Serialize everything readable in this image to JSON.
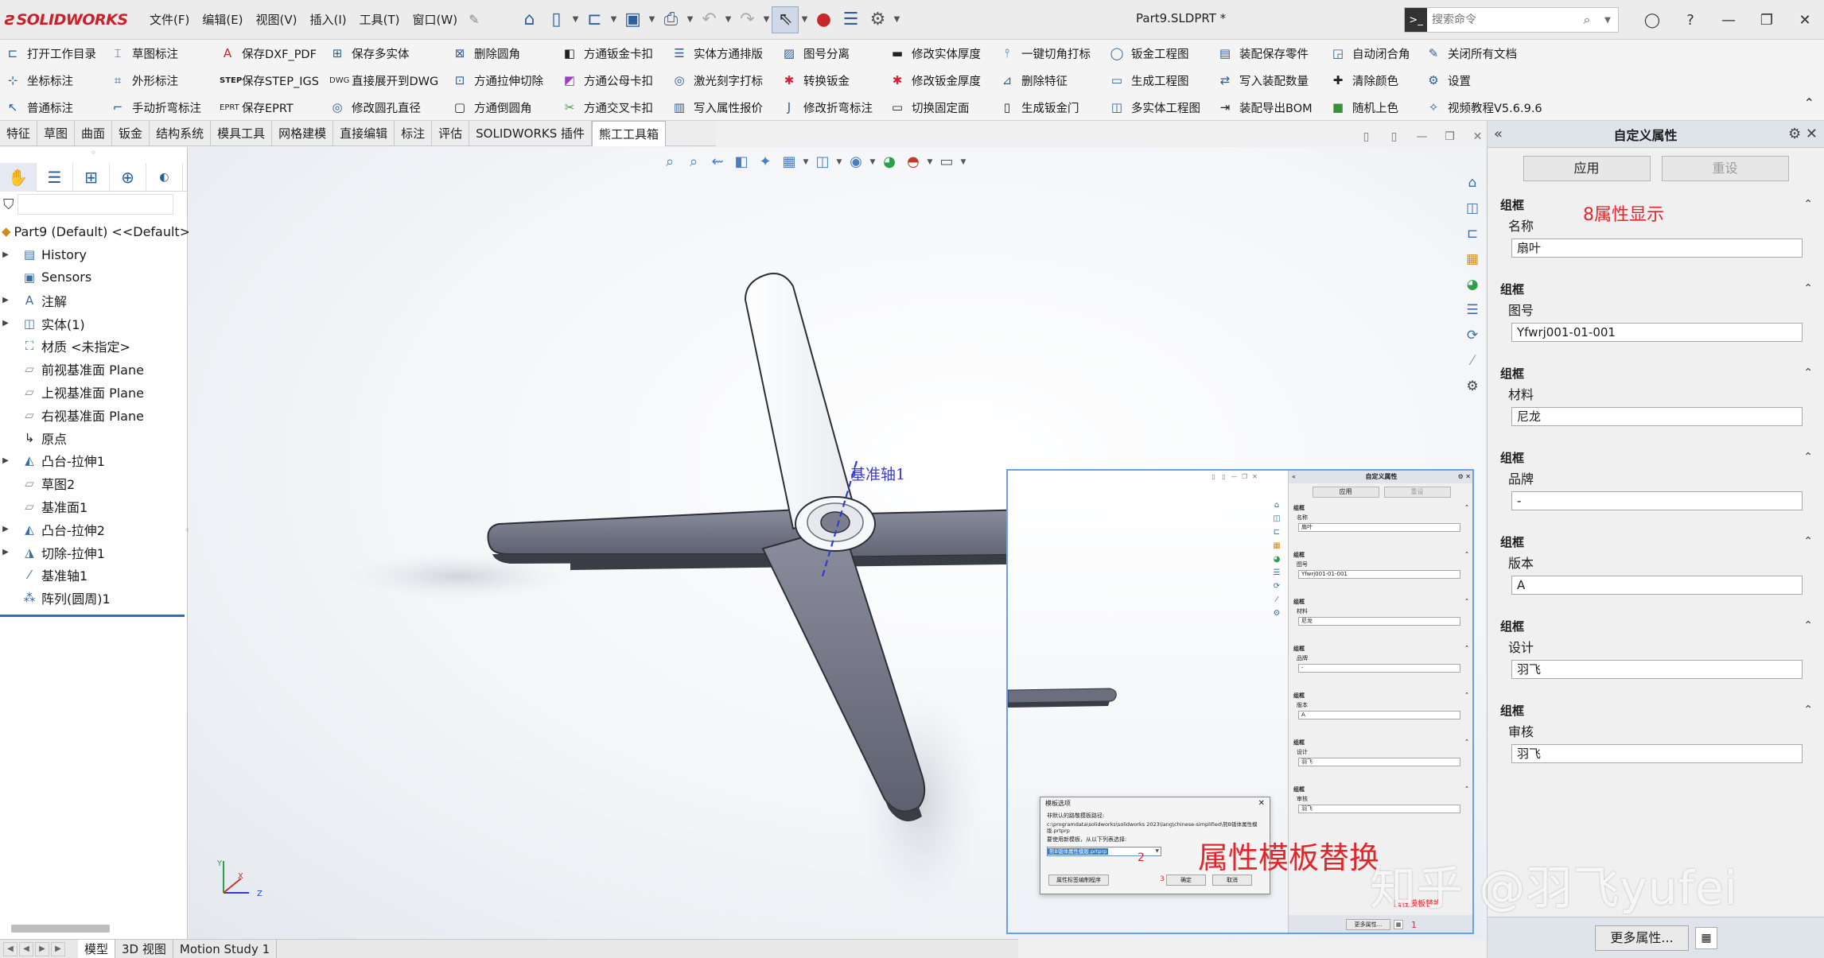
{
  "app": {
    "logo_text": "SOLIDWORKS",
    "menus": [
      "文件(F)",
      "编辑(E)",
      "视图(V)",
      "插入(I)",
      "工具(T)",
      "窗口(W)"
    ],
    "doc_title": "Part9.SLDPRT *",
    "search_placeholder": "搜索命令"
  },
  "ribbon": {
    "row1": [
      "打开工作目录",
      "草图标注",
      "保存DXF_PDF",
      "保存多实体",
      "删除圆角",
      "方通钣金卡扣",
      "实体方通排版",
      "图号分离",
      "修改实体厚度",
      "一键切角打标",
      "钣金工程图",
      "装配保存零件",
      "自动闭合角",
      "关闭所有文档"
    ],
    "row2": [
      "坐标标注",
      "外形标注",
      "保存STEP_IGS",
      "直接展开到DWG",
      "方通拉伸切除",
      "方通公母卡扣",
      "激光刻字打标",
      "转换钣金",
      "修改钣金厚度",
      "删除特征",
      "生成工程图",
      "写入装配数量",
      "清除颜色",
      "设置"
    ],
    "row3": [
      "普通标注",
      "手动折弯标注",
      "保存EPRT",
      "修改圆孔直径",
      "方通倒圆角",
      "方通交叉卡扣",
      "写入属性报价",
      "修改折弯标注",
      "切换固定面",
      "生成钣金门",
      "多实体工程图",
      "装配导出BOM",
      "随机上色",
      "视频教程V5.6.9.6"
    ],
    "icon_labels": {
      "step": "STEP",
      "dwg": "DWG",
      "eprt": "EPRT"
    }
  },
  "tabs": [
    "特征",
    "草图",
    "曲面",
    "钣金",
    "结构系统",
    "模具工具",
    "网格建模",
    "直接编辑",
    "标注",
    "评估",
    "SOLIDWORKS 插件",
    "熊工工具箱"
  ],
  "tree": {
    "root": "Part9  (Default) <<Default>",
    "items": [
      "History",
      "Sensors",
      "注解",
      "实体(1)",
      "材质 <未指定>",
      "前视基准面 Plane",
      "上视基准面 Plane",
      "右视基准面 Plane",
      "原点",
      "凸台-拉伸1",
      "草图2",
      "基准面1",
      "凸台-拉伸2",
      "切除-拉伸1",
      "基准轴1",
      "阵列(圆周)1"
    ]
  },
  "bottom_tabs": [
    "模型",
    "3D 视图",
    "Motion Study 1"
  ],
  "viewport": {
    "axis_label": "基准轴1",
    "triad": {
      "x": "X",
      "y": "Y",
      "z": "Z"
    }
  },
  "right_panel": {
    "title": "自定义属性",
    "apply": "应用",
    "reset": "重设",
    "annotation": "8属性显示",
    "groups": [
      {
        "head": "组框",
        "label": "名称",
        "value": "扇叶"
      },
      {
        "head": "组框",
        "label": "图号",
        "value": "Yfwrj001-01-001"
      },
      {
        "head": "组框",
        "label": "材料",
        "value": "尼龙"
      },
      {
        "head": "组框",
        "label": "品牌",
        "value": "-"
      },
      {
        "head": "组框",
        "label": "版本",
        "value": "A"
      },
      {
        "head": "组框",
        "label": "设计",
        "value": "羽飞"
      },
      {
        "head": "组框",
        "label": "审核",
        "value": "羽飞"
      }
    ],
    "more_button": "更多属性..."
  },
  "inset": {
    "title": "自定义属性",
    "apply": "应用",
    "reset": "重设",
    "groups": [
      {
        "head": "组框",
        "label": "名称",
        "value": "扇叶"
      },
      {
        "head": "组框",
        "label": "图号",
        "value": "Yfwrj001-01-001"
      },
      {
        "head": "组框",
        "label": "材料",
        "value": "尼龙"
      },
      {
        "head": "组框",
        "label": "品牌",
        "value": "-"
      },
      {
        "head": "组框",
        "label": "版本",
        "value": "A"
      },
      {
        "head": "组框",
        "label": "设计",
        "value": "羽飞"
      },
      {
        "head": "组框",
        "label": "审核",
        "value": "羽飞"
      }
    ],
    "more_button": "更多属性...",
    "replace_note": "属性模板替换",
    "num1": "1",
    "dialog": {
      "title": "模板选项",
      "line1": "非默认的路敬模板路径:",
      "path": "c:\\programdata\\solidworks\\solidworks 2023\\lang\\chinese-simplified\\熊B钣体属性模版.prtprp",
      "line2": "要使用新模板，从以下列表选择:",
      "selected": "熊B钣体属性模版.prtprp",
      "edit_btn": "属性标签编制程序",
      "ok": "确定",
      "cancel": "取消",
      "num2": "2",
      "num3": "3"
    }
  },
  "overlay": {
    "big_text": "属性模板替换",
    "watermark": "知乎 @羽飞yufei"
  },
  "colors": {
    "accent_red": "#e3262d",
    "selection_blue": "#2c6fbf",
    "blade_gray": "#6b6e7d",
    "axis_blue": "#3b3bc8"
  }
}
